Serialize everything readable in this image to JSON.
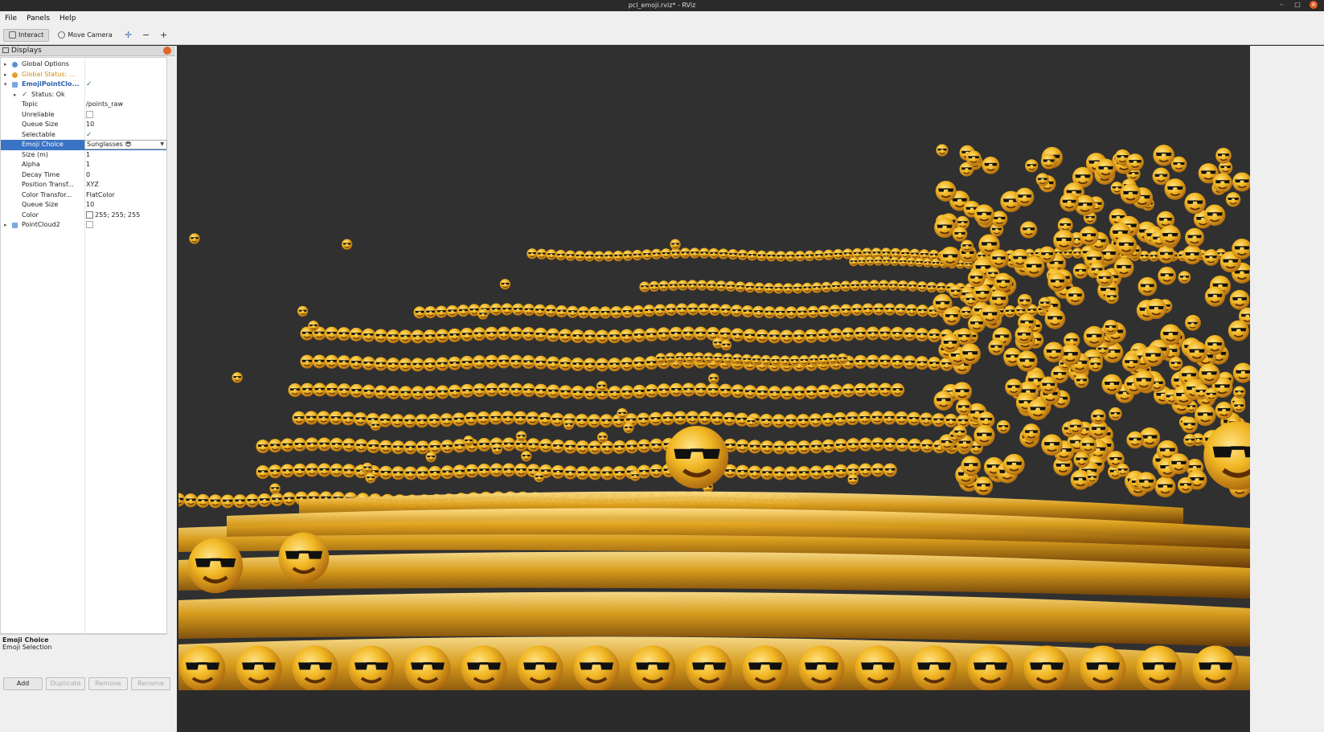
{
  "window": {
    "title": "pcl_emoji.rviz* - RViz"
  },
  "menu": [
    "File",
    "Panels",
    "Help"
  ],
  "toolbar": {
    "interact_label": "Interact",
    "move_camera_label": "Move Camera"
  },
  "displays": {
    "title": "Displays",
    "rows": [
      {
        "name": "Global Options",
        "value": "",
        "indent": 0,
        "kind": "expand"
      },
      {
        "name": "Global Status: ...",
        "value": "",
        "indent": 0,
        "kind": "warning"
      },
      {
        "name": "EmojiPointClo...",
        "value": "✓",
        "indent": 0,
        "kind": "expanded"
      },
      {
        "name": "Status: Ok",
        "value": "",
        "indent": 1,
        "kind": "status"
      },
      {
        "name": "Topic",
        "value": "/points_raw",
        "indent": 2,
        "kind": "prop"
      },
      {
        "name": "Unreliable",
        "value": "",
        "indent": 2,
        "kind": "checkbox"
      },
      {
        "name": "Queue Size",
        "value": "10",
        "indent": 2,
        "kind": "prop"
      },
      {
        "name": "Selectable",
        "value": "✓",
        "indent": 2,
        "kind": "prop"
      },
      {
        "name": "Emoji Choice",
        "value": "Sunglasses 😎",
        "indent": 2,
        "kind": "combo"
      },
      {
        "name": "Size (m)",
        "value": "1",
        "indent": 2,
        "kind": "prop"
      },
      {
        "name": "Alpha",
        "value": "1",
        "indent": 2,
        "kind": "prop"
      },
      {
        "name": "Decay Time",
        "value": "0",
        "indent": 2,
        "kind": "prop"
      },
      {
        "name": "Position Transf...",
        "value": "XYZ",
        "indent": 2,
        "kind": "prop"
      },
      {
        "name": "Color Transfor...",
        "value": "FlatColor",
        "indent": 2,
        "kind": "prop"
      },
      {
        "name": "Queue Size",
        "value": "10",
        "indent": 2,
        "kind": "prop"
      },
      {
        "name": "Color",
        "value": "255; 255; 255",
        "indent": 2,
        "kind": "color"
      },
      {
        "name": "PointCloud2",
        "value": "",
        "indent": 0,
        "kind": "collapsed"
      }
    ]
  },
  "description": {
    "title": "Emoji Choice",
    "text": "Emoji Selection"
  },
  "buttons": [
    "Add",
    "Duplicate",
    "Remove",
    "Rename"
  ],
  "colors": {
    "emoji_yellow": "#f2b824",
    "emoji_dark": "#a8620d",
    "viewport_bg": "#303030",
    "selection": "#3a73c5"
  },
  "viewport": {
    "content": "sunglasses-emoji-point-cloud"
  }
}
